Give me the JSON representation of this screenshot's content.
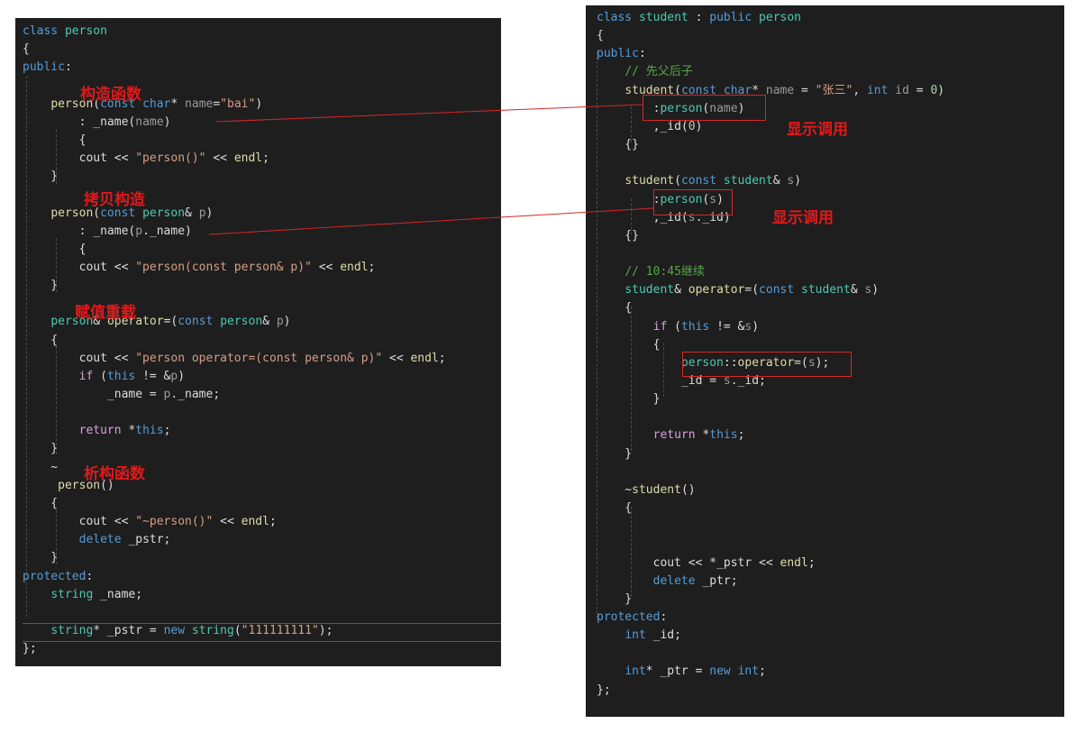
{
  "left": {
    "lines": [
      [
        [
          "kw",
          "class"
        ],
        [
          "pl",
          " "
        ],
        [
          "ty",
          "person"
        ]
      ],
      [
        [
          "pl",
          "{"
        ]
      ],
      [
        [
          "kw",
          "public"
        ],
        [
          "pl",
          ":"
        ]
      ],
      [],
      [
        [
          "pl",
          "    "
        ],
        [
          "fn",
          "person"
        ],
        [
          "pl",
          "("
        ],
        [
          "kw",
          "const"
        ],
        [
          "pl",
          " "
        ],
        [
          "kw",
          "char"
        ],
        [
          "pl",
          "* "
        ],
        [
          "prm",
          "name"
        ],
        [
          "pl",
          "="
        ],
        [
          "str",
          "\"bai\""
        ],
        [
          "pl",
          ")"
        ]
      ],
      [
        [
          "pl",
          "        : "
        ],
        [
          "pl",
          "_name"
        ],
        [
          "pl",
          "("
        ],
        [
          "prm",
          "name"
        ],
        [
          "pl",
          ")"
        ]
      ],
      [
        [
          "pl",
          "        {"
        ]
      ],
      [
        [
          "pl",
          "        cout << "
        ],
        [
          "str",
          "\"person()\""
        ],
        [
          "pl",
          " << "
        ],
        [
          "fn",
          "endl"
        ],
        [
          "pl",
          ";"
        ]
      ],
      [
        [
          "pl",
          "    }"
        ]
      ],
      [],
      [
        [
          "pl",
          "    "
        ],
        [
          "fn",
          "person"
        ],
        [
          "pl",
          "("
        ],
        [
          "kw",
          "const"
        ],
        [
          "pl",
          " "
        ],
        [
          "ty",
          "person"
        ],
        [
          "pl",
          "& "
        ],
        [
          "prm",
          "p"
        ],
        [
          "pl",
          ")"
        ]
      ],
      [
        [
          "pl",
          "        : "
        ],
        [
          "pl",
          "_name"
        ],
        [
          "pl",
          "("
        ],
        [
          "prm",
          "p"
        ],
        [
          "pl",
          "._name)"
        ]
      ],
      [
        [
          "pl",
          "        {"
        ]
      ],
      [
        [
          "pl",
          "        cout << "
        ],
        [
          "str",
          "\"person(const person& p)\""
        ],
        [
          "pl",
          " << "
        ],
        [
          "fn",
          "endl"
        ],
        [
          "pl",
          ";"
        ]
      ],
      [
        [
          "pl",
          "    }"
        ]
      ],
      [],
      [
        [
          "pl",
          "    "
        ],
        [
          "ty",
          "person"
        ],
        [
          "pl",
          "& "
        ],
        [
          "fn",
          "operator"
        ],
        [
          "pl",
          "=("
        ],
        [
          "kw",
          "const"
        ],
        [
          "pl",
          " "
        ],
        [
          "ty",
          "person"
        ],
        [
          "pl",
          "& "
        ],
        [
          "prm",
          "p"
        ],
        [
          "pl",
          ")"
        ]
      ],
      [
        [
          "pl",
          "    {"
        ]
      ],
      [
        [
          "pl",
          "        cout << "
        ],
        [
          "str",
          "\"person operator=(const person& p)\""
        ],
        [
          "pl",
          " << "
        ],
        [
          "fn",
          "endl"
        ],
        [
          "pl",
          ";"
        ]
      ],
      [
        [
          "pl",
          "        "
        ],
        [
          "ctl",
          "if"
        ],
        [
          "pl",
          " ("
        ],
        [
          "kw",
          "this"
        ],
        [
          "pl",
          " != &"
        ],
        [
          "prm",
          "p"
        ],
        [
          "pl",
          ")"
        ]
      ],
      [
        [
          "pl",
          "            _name = "
        ],
        [
          "prm",
          "p"
        ],
        [
          "pl",
          "._name;"
        ]
      ],
      [],
      [
        [
          "pl",
          "        "
        ],
        [
          "ctl",
          "return"
        ],
        [
          "pl",
          " *"
        ],
        [
          "kw",
          "this"
        ],
        [
          "pl",
          ";"
        ]
      ],
      [
        [
          "pl",
          "    }"
        ]
      ],
      [
        [
          "pl",
          "    ~"
        ]
      ],
      [
        [
          "pl",
          "     "
        ],
        [
          "fn",
          "person"
        ],
        [
          "pl",
          "()"
        ]
      ],
      [
        [
          "pl",
          "    {"
        ]
      ],
      [
        [
          "pl",
          "        cout << "
        ],
        [
          "str",
          "\"~person()\""
        ],
        [
          "pl",
          " << "
        ],
        [
          "fn",
          "endl"
        ],
        [
          "pl",
          ";"
        ]
      ],
      [
        [
          "pl",
          "        "
        ],
        [
          "kw",
          "delete"
        ],
        [
          "pl",
          " _pstr;"
        ]
      ],
      [
        [
          "pl",
          "    }"
        ]
      ],
      [
        [
          "kw",
          "protected"
        ],
        [
          "pl",
          ":"
        ]
      ],
      [
        [
          "pl",
          "    "
        ],
        [
          "ty",
          "string"
        ],
        [
          "pl",
          " _name;"
        ]
      ],
      [],
      [
        [
          "pl",
          "    "
        ],
        [
          "ty",
          "string"
        ],
        [
          "pl",
          "* _pstr = "
        ],
        [
          "kw",
          "new"
        ],
        [
          "pl",
          " "
        ],
        [
          "ty",
          "string"
        ],
        [
          "pl",
          "("
        ],
        [
          "str",
          "\"111111111\""
        ],
        [
          "pl",
          ");"
        ]
      ],
      [
        [
          "pl",
          "};"
        ]
      ]
    ],
    "notes": [
      "构造函数",
      "拷贝构造",
      "赋值重载",
      "析构函数"
    ]
  },
  "right": {
    "lines": [
      [
        [
          "kw",
          "class"
        ],
        [
          "pl",
          " "
        ],
        [
          "ty",
          "student"
        ],
        [
          "pl",
          " : "
        ],
        [
          "kw",
          "public"
        ],
        [
          "pl",
          " "
        ],
        [
          "ty",
          "person"
        ]
      ],
      [
        [
          "pl",
          "{"
        ]
      ],
      [
        [
          "kw",
          "public"
        ],
        [
          "pl",
          ":"
        ]
      ],
      [
        [
          "pl",
          "    "
        ],
        [
          "cm",
          "// 先父后子"
        ]
      ],
      [
        [
          "pl",
          "    "
        ],
        [
          "fn",
          "student"
        ],
        [
          "pl",
          "("
        ],
        [
          "kw",
          "const"
        ],
        [
          "pl",
          " "
        ],
        [
          "kw",
          "char"
        ],
        [
          "pl",
          "* "
        ],
        [
          "prm",
          "name"
        ],
        [
          "pl",
          " = "
        ],
        [
          "str",
          "\"张三\""
        ],
        [
          "pl",
          ", "
        ],
        [
          "kw",
          "int"
        ],
        [
          "pl",
          " "
        ],
        [
          "prm",
          "id"
        ],
        [
          "pl",
          " = "
        ],
        [
          "num",
          "0"
        ],
        [
          "pl",
          ")"
        ]
      ],
      [
        [
          "pl",
          "        :"
        ],
        [
          "ty",
          "person"
        ],
        [
          "pl",
          "("
        ],
        [
          "prm",
          "name"
        ],
        [
          "pl",
          ")"
        ]
      ],
      [
        [
          "pl",
          "        ,_id("
        ],
        [
          "num",
          "0"
        ],
        [
          "pl",
          ")"
        ]
      ],
      [
        [
          "pl",
          "    {}"
        ]
      ],
      [],
      [
        [
          "pl",
          "    "
        ],
        [
          "fn",
          "student"
        ],
        [
          "pl",
          "("
        ],
        [
          "kw",
          "const"
        ],
        [
          "pl",
          " "
        ],
        [
          "ty",
          "student"
        ],
        [
          "pl",
          "& "
        ],
        [
          "prm",
          "s"
        ],
        [
          "pl",
          ")"
        ]
      ],
      [
        [
          "pl",
          "        :"
        ],
        [
          "ty",
          "person"
        ],
        [
          "pl",
          "("
        ],
        [
          "prm",
          "s"
        ],
        [
          "pl",
          ")"
        ]
      ],
      [
        [
          "pl",
          "        ,_id("
        ],
        [
          "prm",
          "s"
        ],
        [
          "pl",
          "._id)"
        ]
      ],
      [
        [
          "pl",
          "    {}"
        ]
      ],
      [],
      [
        [
          "pl",
          "    "
        ],
        [
          "cm",
          "// 10:45继续"
        ]
      ],
      [
        [
          "pl",
          "    "
        ],
        [
          "ty",
          "student"
        ],
        [
          "pl",
          "& "
        ],
        [
          "fn",
          "operator"
        ],
        [
          "pl",
          "=("
        ],
        [
          "kw",
          "const"
        ],
        [
          "pl",
          " "
        ],
        [
          "ty",
          "student"
        ],
        [
          "pl",
          "& "
        ],
        [
          "prm",
          "s"
        ],
        [
          "pl",
          ")"
        ]
      ],
      [
        [
          "pl",
          "    {"
        ]
      ],
      [
        [
          "pl",
          "        "
        ],
        [
          "ctl",
          "if"
        ],
        [
          "pl",
          " ("
        ],
        [
          "kw",
          "this"
        ],
        [
          "pl",
          " != &"
        ],
        [
          "prm",
          "s"
        ],
        [
          "pl",
          ")"
        ]
      ],
      [
        [
          "pl",
          "        {"
        ]
      ],
      [
        [
          "pl",
          "            "
        ],
        [
          "ty",
          "person"
        ],
        [
          "pl",
          "::"
        ],
        [
          "fn",
          "operator"
        ],
        [
          "pl",
          "=("
        ],
        [
          "prm",
          "s"
        ],
        [
          "pl",
          ");"
        ]
      ],
      [
        [
          "pl",
          "            _id = "
        ],
        [
          "prm",
          "s"
        ],
        [
          "pl",
          "._id;"
        ]
      ],
      [
        [
          "pl",
          "        }"
        ]
      ],
      [],
      [
        [
          "pl",
          "        "
        ],
        [
          "ctl",
          "return"
        ],
        [
          "pl",
          " *"
        ],
        [
          "kw",
          "this"
        ],
        [
          "pl",
          ";"
        ]
      ],
      [
        [
          "pl",
          "    }"
        ]
      ],
      [],
      [
        [
          "pl",
          "    ~"
        ],
        [
          "fn",
          "student"
        ],
        [
          "pl",
          "()"
        ]
      ],
      [
        [
          "pl",
          "    {"
        ]
      ],
      [],
      [],
      [
        [
          "pl",
          "        cout << *_pstr << "
        ],
        [
          "fn",
          "endl"
        ],
        [
          "pl",
          ";"
        ]
      ],
      [
        [
          "pl",
          "        "
        ],
        [
          "kw",
          "delete"
        ],
        [
          "pl",
          " _ptr;"
        ]
      ],
      [
        [
          "pl",
          "    }"
        ]
      ],
      [
        [
          "kw",
          "protected"
        ],
        [
          "pl",
          ":"
        ]
      ],
      [
        [
          "pl",
          "    "
        ],
        [
          "kw",
          "int"
        ],
        [
          "pl",
          " _id;"
        ]
      ],
      [],
      [
        [
          "pl",
          "    "
        ],
        [
          "kw",
          "int"
        ],
        [
          "pl",
          "* _ptr = "
        ],
        [
          "kw",
          "new"
        ],
        [
          "pl",
          " "
        ],
        [
          "kw",
          "int"
        ],
        [
          "pl",
          ";"
        ]
      ],
      [
        [
          "pl",
          "};"
        ]
      ]
    ],
    "notes": [
      "显示调用",
      "显示调用"
    ]
  },
  "colors": {
    "editor_bg": "#1e1e1e",
    "annotation_red": "#e0191c",
    "keyword": "#569cd6",
    "type": "#4ec9b0",
    "string": "#d69d85",
    "comment": "#57a64a"
  }
}
